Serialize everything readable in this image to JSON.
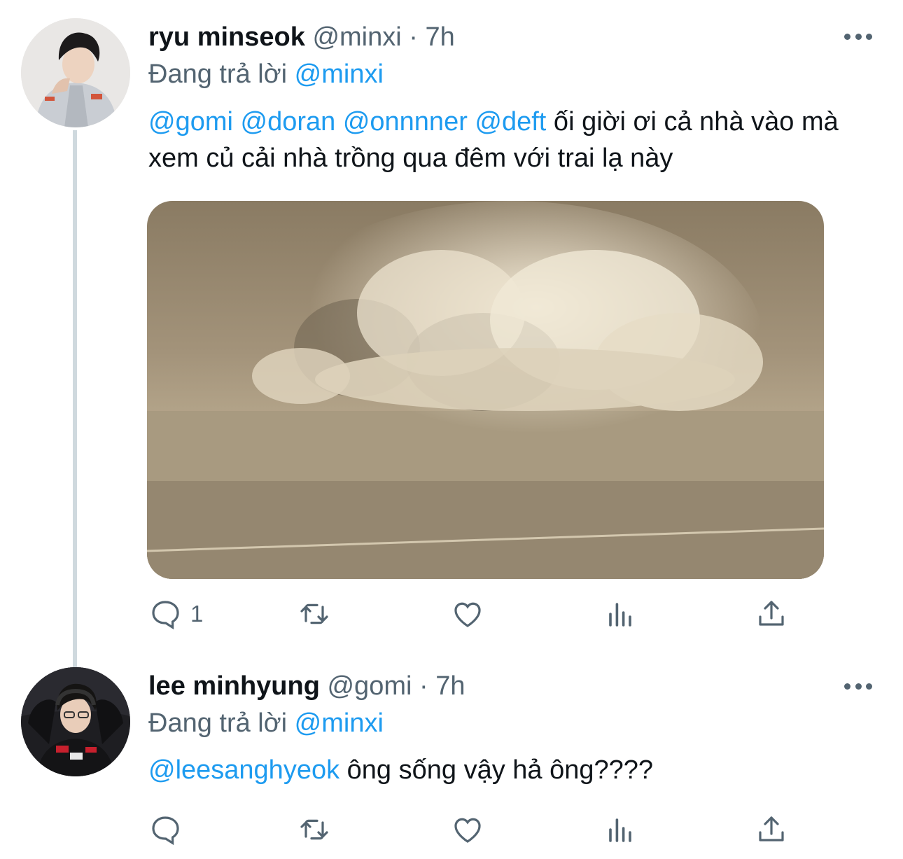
{
  "tweets": [
    {
      "display_name": "ryu minseok",
      "handle": "@minxi",
      "separator": "·",
      "time": "7h",
      "reply_prefix": "Đang trả lời",
      "reply_handle": "@minxi",
      "mentions": "@gomi @doran @onnnner @deft",
      "text": " ối giời ơi cả nhà vào mà xem củ cải nhà trồng qua đêm với trai lạ này",
      "reply_count": "1",
      "media": "explosion-dust-cloud-image"
    },
    {
      "display_name": "lee minhyung",
      "handle": "@gomi",
      "separator": "·",
      "time": "7h",
      "reply_prefix": "Đang trả lời",
      "reply_handle": "@minxi",
      "mentions": "@leesanghyeok",
      "text": " ông sống vậy hả ông????",
      "reply_count": ""
    }
  ],
  "icons": {
    "reply": "speech-bubble-icon",
    "retweet": "retweet-arrows-icon",
    "like": "heart-icon",
    "views": "bar-chart-icon",
    "share": "share-upload-icon",
    "more": "more-dots-icon"
  },
  "colors": {
    "link": "#1d9bf0",
    "secondary_text": "#536471",
    "thread_line": "#cfd9de"
  }
}
